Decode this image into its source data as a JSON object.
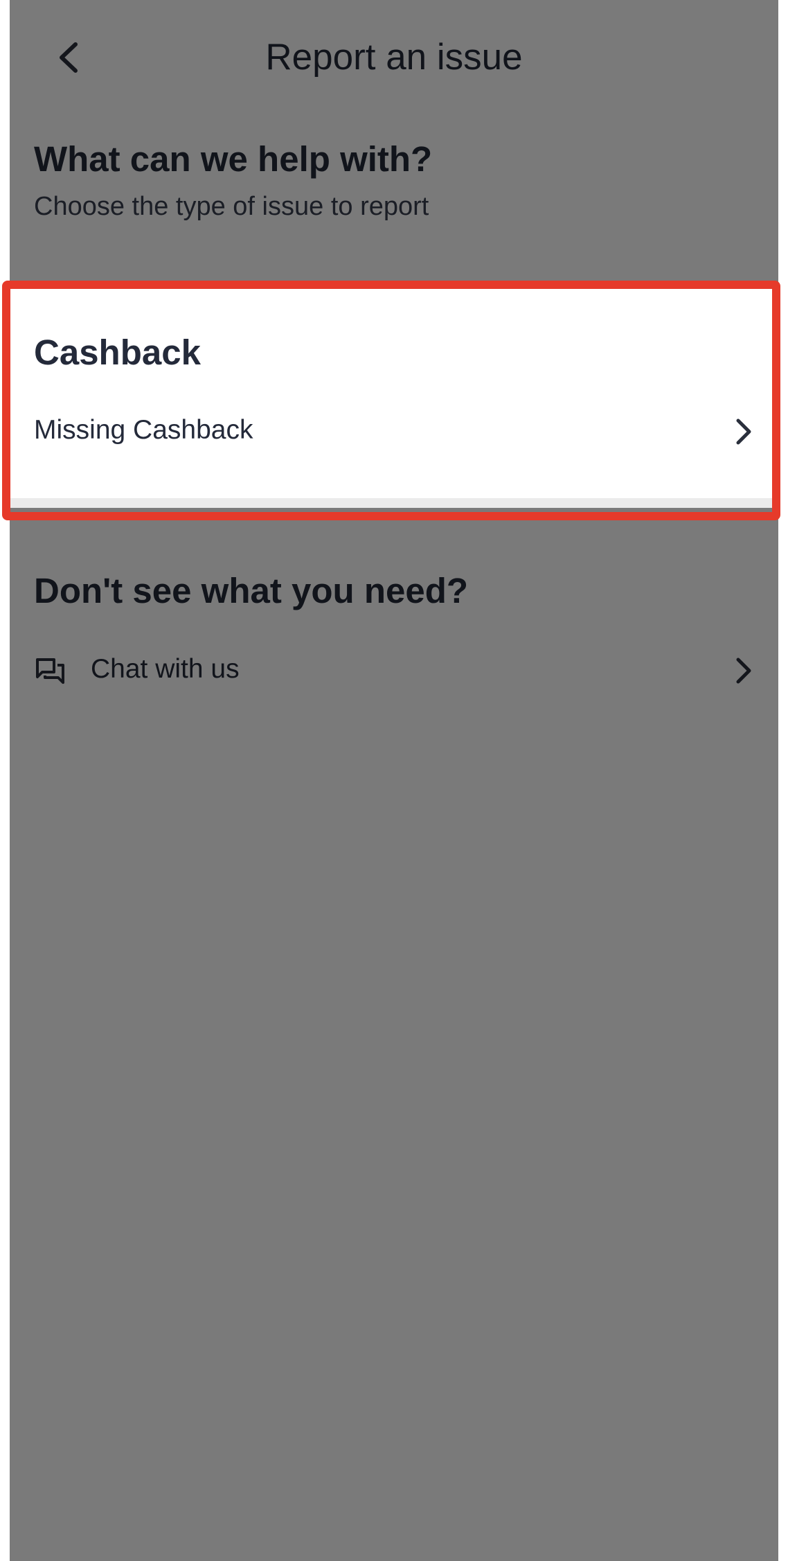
{
  "header": {
    "title": "Report an issue",
    "back_icon": "chevron-left-icon"
  },
  "intro": {
    "heading": "What can we help with?",
    "subheading": "Choose the type of issue to report"
  },
  "categories": [
    {
      "title": "Cashback",
      "items": [
        {
          "label": "Missing Cashback",
          "icon": "chevron-right-icon"
        }
      ]
    }
  ],
  "help": {
    "heading": "Don't see what you need?",
    "chat_label": "Chat with us",
    "chat_icon": "chat-bubbles-icon"
  },
  "colors": {
    "highlight": "#e63a2a",
    "text_primary": "#242a3a",
    "dim_overlay": "rgba(0,0,0,0.52)"
  }
}
